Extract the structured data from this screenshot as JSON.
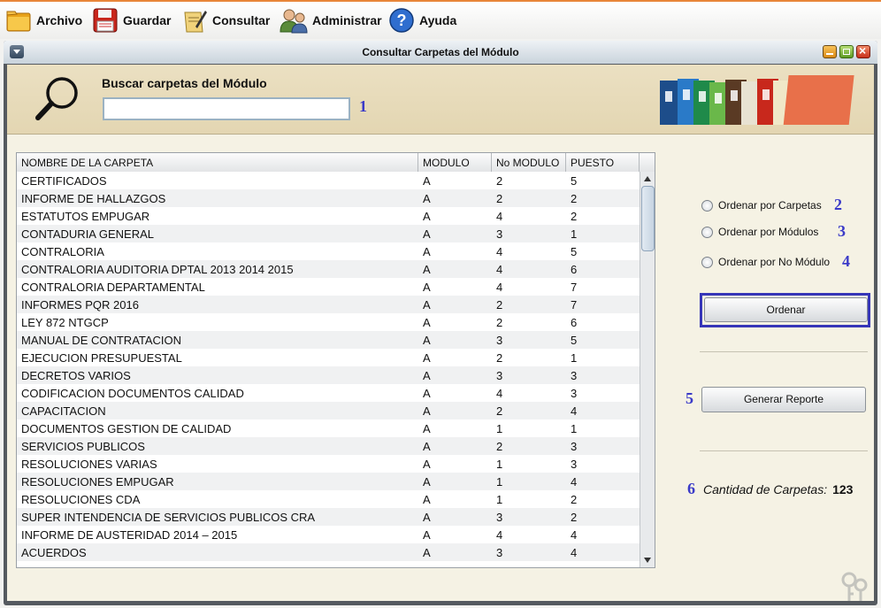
{
  "menu": [
    {
      "label": "Archivo",
      "icon": "folder-icon"
    },
    {
      "label": "Guardar",
      "icon": "floppy-disk-icon"
    },
    {
      "label": "Consultar",
      "icon": "document-pen-icon"
    },
    {
      "label": "Administrar",
      "icon": "users-icon"
    },
    {
      "label": "Ayuda",
      "icon": "help-icon"
    }
  ],
  "window": {
    "title": "Consultar Carpetas del Módulo"
  },
  "search": {
    "title": "Buscar carpetas del Módulo",
    "value": "",
    "marker": "1"
  },
  "table": {
    "columns": [
      "NOMBRE DE LA CARPETA",
      "MODULO",
      "No MODULO",
      "PUESTO"
    ],
    "rows": [
      [
        "CERTIFICADOS",
        "A",
        "2",
        "5"
      ],
      [
        "INFORME DE HALLAZGOS",
        "A",
        "2",
        "2"
      ],
      [
        "ESTATUTOS EMPUGAR",
        "A",
        "4",
        "2"
      ],
      [
        "CONTADURIA GENERAL",
        "A",
        "3",
        "1"
      ],
      [
        "CONTRALORIA",
        "A",
        "4",
        "5"
      ],
      [
        "CONTRALORIA AUDITORIA DPTAL 2013 2014 2015",
        "A",
        "4",
        "6"
      ],
      [
        "CONTRALORIA DEPARTAMENTAL",
        "A",
        "4",
        "7"
      ],
      [
        "INFORMES PQR 2016",
        "A",
        "2",
        "7"
      ],
      [
        "LEY 872 NTGCP",
        "A",
        "2",
        "6"
      ],
      [
        "MANUAL DE CONTRATACION",
        "A",
        "3",
        "5"
      ],
      [
        "EJECUCION PRESUPUESTAL",
        "A",
        "2",
        "1"
      ],
      [
        "DECRETOS VARIOS",
        "A",
        "3",
        "3"
      ],
      [
        "CODIFICACION DOCUMENTOS CALIDAD",
        "A",
        "4",
        "3"
      ],
      [
        "CAPACITACION",
        "A",
        "2",
        "4"
      ],
      [
        "DOCUMENTOS GESTION DE CALIDAD",
        "A",
        "1",
        "1"
      ],
      [
        "SERVICIOS PUBLICOS",
        "A",
        "2",
        "3"
      ],
      [
        "RESOLUCIONES VARIAS",
        "A",
        "1",
        "3"
      ],
      [
        "RESOLUCIONES EMPUGAR",
        "A",
        "1",
        "4"
      ],
      [
        "RESOLUCIONES CDA",
        "A",
        "1",
        "2"
      ],
      [
        "SUPER INTENDENCIA DE SERVICIOS PUBLICOS CRA",
        "A",
        "3",
        "2"
      ],
      [
        "INFORME DE AUSTERIDAD 2014 – 2015",
        "A",
        "4",
        "4"
      ],
      [
        "ACUERDOS",
        "A",
        "3",
        "4"
      ]
    ]
  },
  "sort_options": [
    {
      "label": "Ordenar por Carpetas",
      "marker": "2"
    },
    {
      "label": "Ordenar por Módulos",
      "marker": "3"
    },
    {
      "label": "Ordenar por No Módulo",
      "marker": "4"
    }
  ],
  "buttons": {
    "ordenar": "Ordenar",
    "reporte": "Generar Reporte",
    "reporte_marker": "5"
  },
  "count": {
    "label": "Cantidad de Carpetas:",
    "value": "123",
    "marker": "6"
  }
}
